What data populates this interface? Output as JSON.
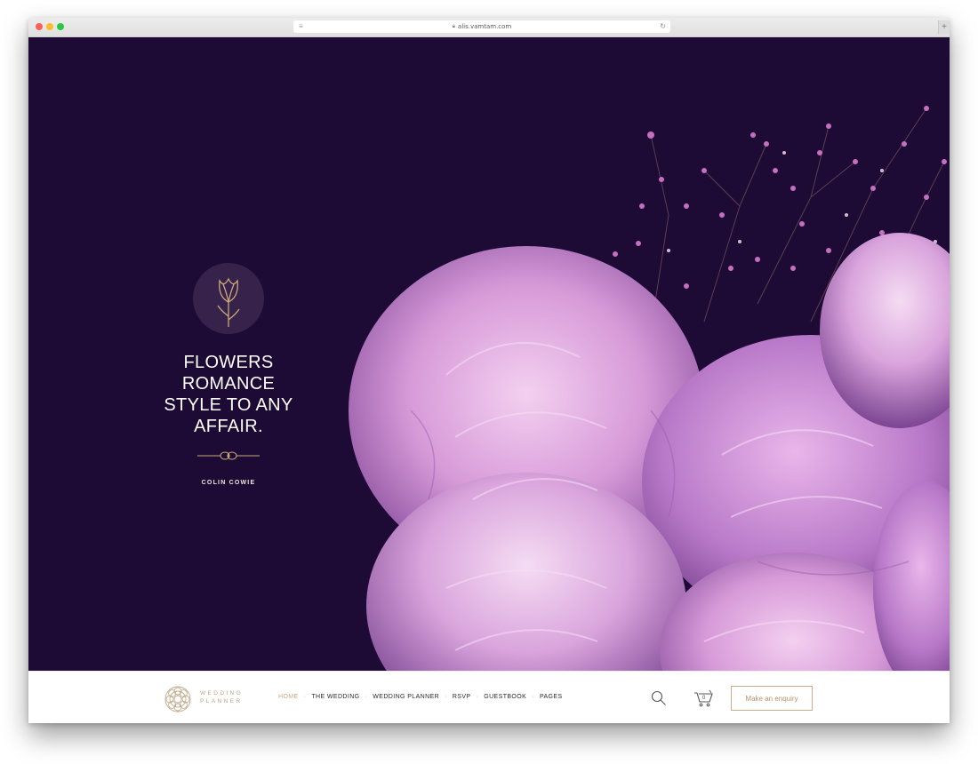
{
  "browser": {
    "url": "alis.vamtam.com"
  },
  "hero": {
    "quote": "FLOWERS\nROMANCE\nSTYLE TO ANY\nAFFAIR.",
    "author": "COLIN COWIE"
  },
  "nav": {
    "logo_text": "WEDDING\nPLANNER",
    "items": [
      {
        "label": "HOME",
        "active": true
      },
      {
        "label": "THE WEDDING",
        "active": false
      },
      {
        "label": "WEDDING PLANNER",
        "active": false
      },
      {
        "label": "RSVP",
        "active": false
      },
      {
        "label": "GUESTBOOK",
        "active": false
      },
      {
        "label": "PAGES",
        "active": false
      }
    ],
    "separator": "·",
    "cart_count": "0",
    "enquiry_label": "Make an enquiry"
  },
  "icons": {
    "reader": "reader-icon",
    "lock": "lock-icon",
    "reload": "reload-icon",
    "emblem": "tulip-icon",
    "search": "search-icon",
    "cart": "cart-icon"
  },
  "colors": {
    "hero_bg": "#1d0b36",
    "accent_gold": "#c8a87e",
    "peony_pink": "#c98bd6"
  }
}
